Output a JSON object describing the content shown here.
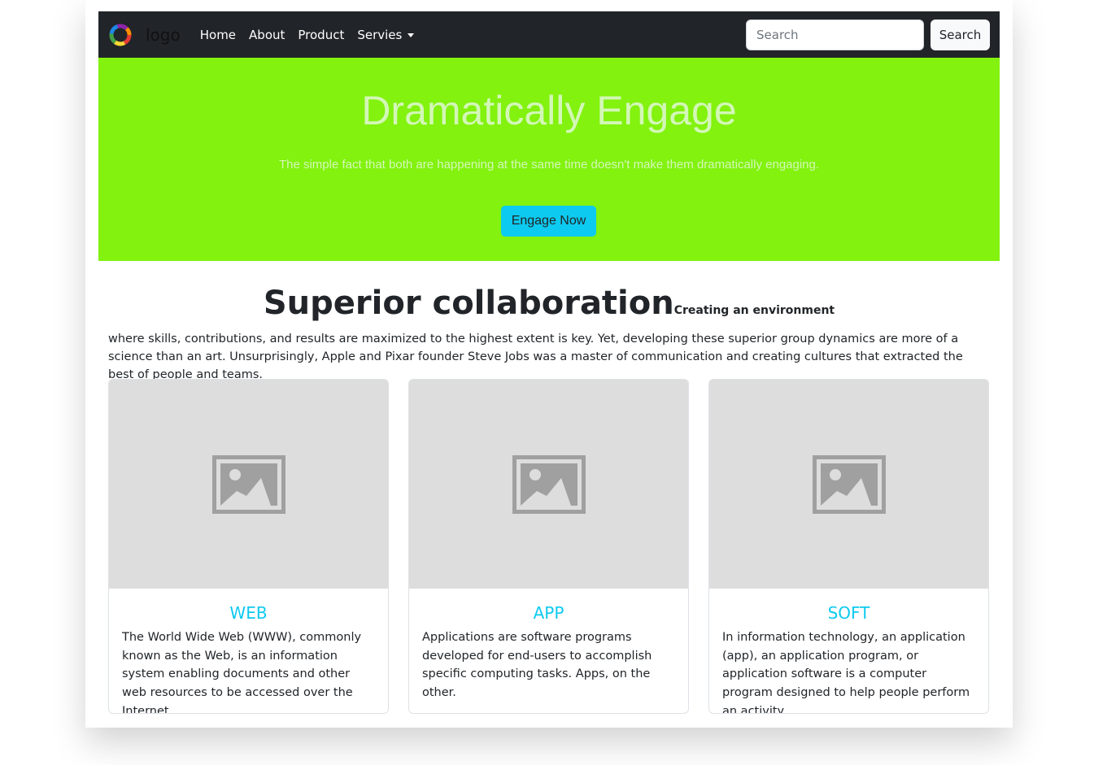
{
  "colors": {
    "navbar_bg": "#212529",
    "hero_bg": "#82f20e",
    "hero_text": "#d3f7b7",
    "accent": "#0dcaf0",
    "card_image_bg": "#dddddd"
  },
  "navbar": {
    "brand": "logo",
    "logo_icon": "colorful-ring-logo-icon",
    "links": [
      "Home",
      "About",
      "Product"
    ],
    "dropdown_label": "Servies",
    "search_placeholder": "Search",
    "search_button": "Search"
  },
  "hero": {
    "title": "Dramatically Engage",
    "subtitle": "The simple fact that both are happening at the same time doesn't make them dramatically engaging.",
    "button": "Engage Now"
  },
  "section": {
    "title": "Superior collaboration",
    "kicker": "Creating an environment",
    "text": "where skills, contributions, and results are maximized to the highest extent is key. Yet, developing these superior group dynamics are more of a science than an art. Unsurprisingly, Apple and Pixar founder Steve Jobs was a master of communication and creating cultures that extracted the best of people and teams."
  },
  "cards": [
    {
      "image_icon": "image-placeholder-icon",
      "title": "WEB",
      "text": "The World Wide Web (WWW), commonly known as the Web, is an information system enabling documents and other web resources to be accessed over the Internet."
    },
    {
      "image_icon": "image-placeholder-icon",
      "title": "APP",
      "text": "Applications are software programs developed for end-users to accomplish specific computing tasks. Apps, on the other."
    },
    {
      "image_icon": "image-placeholder-icon",
      "title": "SOFT",
      "text": "In information technology, an application (app), an application program, or application software is a computer program designed to help people perform an activity."
    }
  ]
}
